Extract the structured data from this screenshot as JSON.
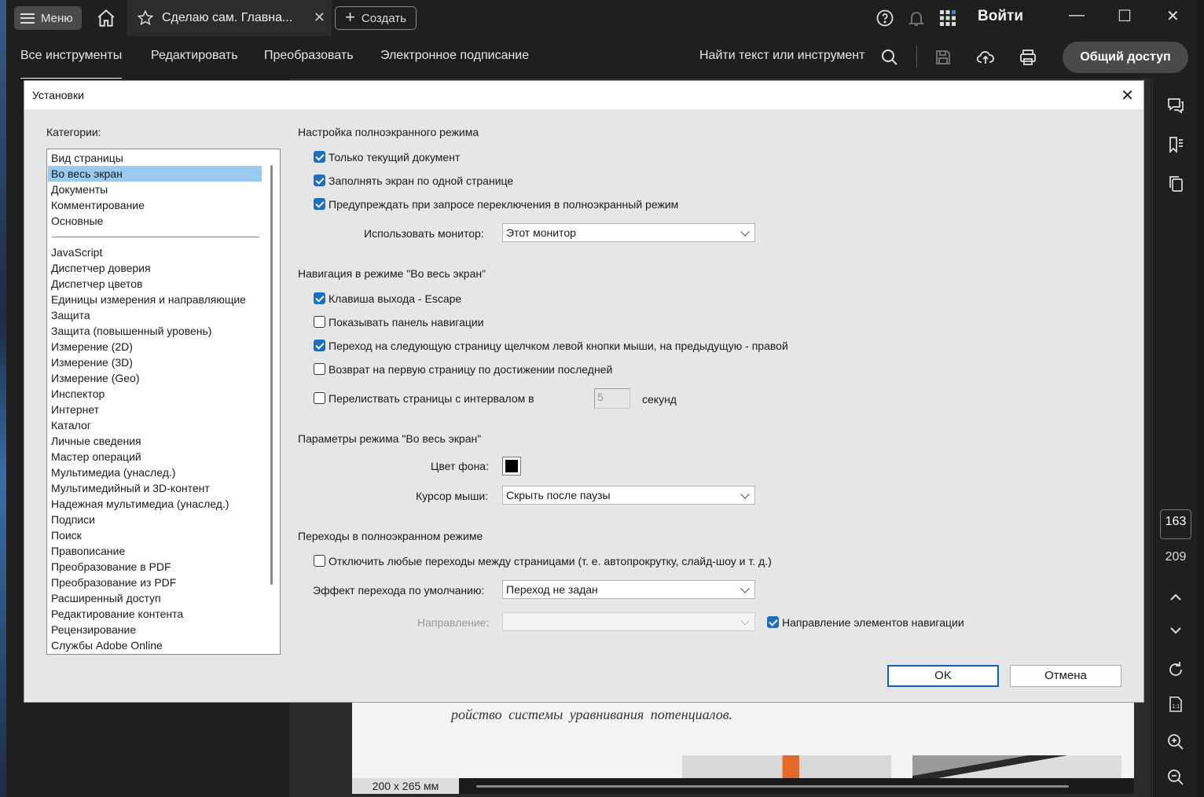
{
  "titlebar": {
    "menu_label": "Меню",
    "tab_title": "Сделаю сам. Главна...",
    "tab_close": "✕",
    "create_label": "Создать",
    "signin": "Войти",
    "minimize": "—",
    "maximize": "☐",
    "close": "✕"
  },
  "toolbar": {
    "tabs": [
      "Все инструменты",
      "Редактировать",
      "Преобразовать",
      "Электронное подписание"
    ],
    "find": "Найти текст или инструмент",
    "share": "Общий доступ"
  },
  "rail": {
    "page_current": "163",
    "page_total": "209"
  },
  "document": {
    "italic_text": "ройство системы уравнивания потенциалов.",
    "page_size": "200 x 265 мм"
  },
  "dialog": {
    "title": "Установки",
    "close": "✕",
    "categories_label": "Категории:",
    "categories_top": [
      "Вид страницы",
      "Во весь экран",
      "Документы",
      "Комментирование",
      "Основные"
    ],
    "categories": [
      "JavaScript",
      "Диспетчер доверия",
      "Диспетчер цветов",
      "Единицы измерения и направляющие",
      "Защита",
      "Защита (повышенный уровень)",
      "Измерение (2D)",
      "Измерение (3D)",
      "Измерение (Geo)",
      "Инспектор",
      "Интернет",
      "Каталог",
      "Личные сведения",
      "Мастер операций",
      "Мультимедиа (унаслед.)",
      "Мультимедийный и 3D-контент",
      "Надежная мультимедиа (унаслед.)",
      "Подписи",
      "Поиск",
      "Правописание",
      "Преобразование в PDF",
      "Преобразование из PDF",
      "Расширенный доступ",
      "Редактирование контента",
      "Рецензирование",
      "Службы Adobe Online"
    ],
    "selected_category": "Во весь экран",
    "section1": {
      "title": "Настройка полноэкранного режима",
      "opt1": "Только текущий документ",
      "opt2": "Заполнять экран по одной странице",
      "opt3": "Предупреждать при запросе переключения в полноэкранный режим",
      "monitor_label": "Использовать монитор:",
      "monitor_value": "Этот монитор"
    },
    "section2": {
      "title": "Навигация в режиме \"Во весь экран\"",
      "opt1": "Клавиша выхода - Escape",
      "opt2": "Показывать панель навигации",
      "opt3": "Переход на следующую страницу щелчком левой кнопки мыши, на предыдущую - правой",
      "opt4": "Возврат на первую страницу по достижении последней",
      "opt5": "Перелиствать страницы с интервалом в",
      "interval_value": "5",
      "seconds": "секунд"
    },
    "section3": {
      "title": "Параметры режима \"Во весь экран\"",
      "bg_label": "Цвет фона:",
      "bg_color": "#000000",
      "cursor_label": "Курсор мыши:",
      "cursor_value": "Скрыть после паузы"
    },
    "section4": {
      "title": "Переходы в полноэкранном режиме",
      "opt1": "Отключить любые переходы между страницами (т. е. автопрокрутку, слайд-шоу и т. д.)",
      "effect_label": "Эффект перехода по умолчанию:",
      "effect_value": "Переход не задан",
      "direction_label": "Направление:",
      "direction_value": "",
      "nav_direction": "Направление элементов навигации"
    },
    "ok": "OK",
    "cancel": "Отмена"
  }
}
